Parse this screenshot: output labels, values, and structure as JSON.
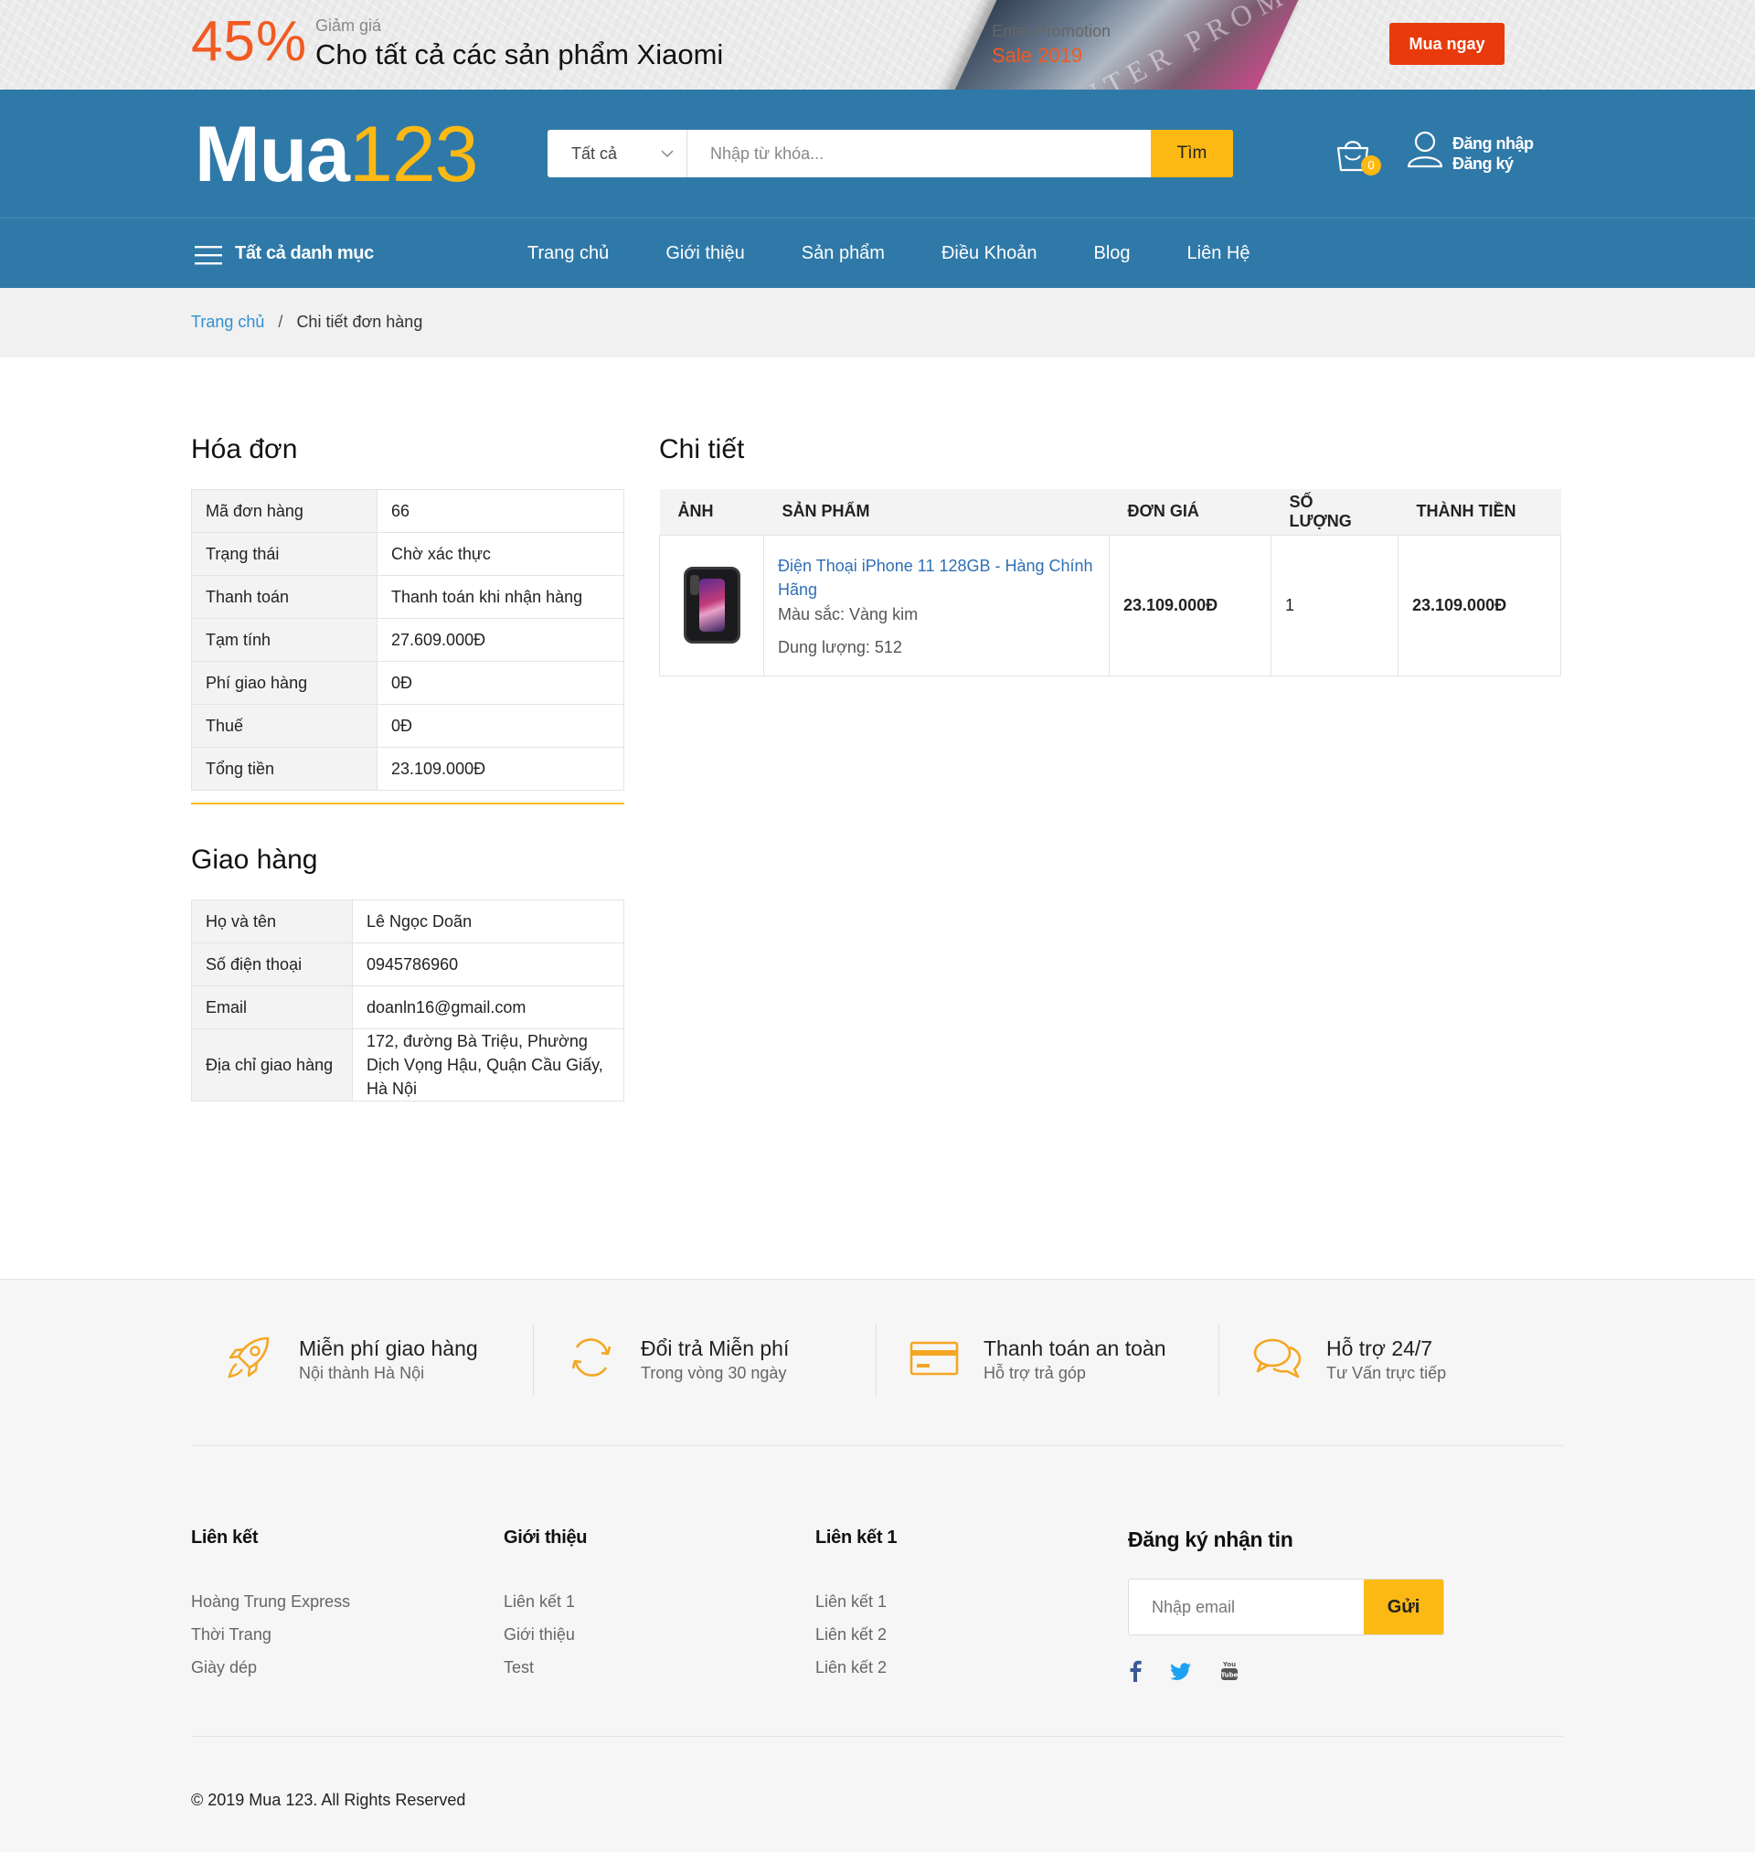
{
  "promo": {
    "percent": "45%",
    "small_text": "Giảm giá",
    "headline": "Cho tất cả các sản phẩm Xiaomi",
    "book_text": "ENTER PROMOTION",
    "enter_text": "Enter Promotion",
    "sale_text": "Sale 2019",
    "button": "Mua ngay",
    "accent_color": "#f15a22",
    "button_color": "#e83a0c"
  },
  "header": {
    "logo_part1": "Mua",
    "logo_part2": "123",
    "search_category": "Tất cả",
    "search_placeholder": "Nhập từ khóa...",
    "search_button": "Tìm",
    "cart_count": "0",
    "login": "Đăng nhập",
    "register": "Đăng ký",
    "brand_color": "#2f79a8",
    "accent_color": "#fdb913"
  },
  "nav": {
    "all_categories": "Tất cả danh mục",
    "items": [
      "Trang chủ",
      "Giới thiệu",
      "Sản phẩm",
      "Điều Khoản",
      "Blog",
      "Liên Hệ"
    ]
  },
  "breadcrumb": {
    "home": "Trang chủ",
    "separator": "/",
    "current": "Chi tiết đơn hàng"
  },
  "invoice": {
    "title": "Hóa đơn",
    "rows": [
      {
        "label": "Mã đơn hàng",
        "value": "66"
      },
      {
        "label": "Trạng thái",
        "value": "Chờ xác thực"
      },
      {
        "label": "Thanh toán",
        "value": "Thanh toán khi nhận hàng"
      },
      {
        "label": "Tạm tính",
        "value": "27.609.000Đ"
      },
      {
        "label": "Phí giao hàng",
        "value": "0Đ"
      },
      {
        "label": "Thuế",
        "value": "0Đ"
      },
      {
        "label": "Tổng tiền",
        "value": "23.109.000Đ"
      }
    ]
  },
  "shipping": {
    "title": "Giao hàng",
    "rows": [
      {
        "label": "Họ và tên",
        "value": "Lê Ngọc Doãn"
      },
      {
        "label": "Số điện thoại",
        "value": "0945786960"
      },
      {
        "label": "Email",
        "value": "doanln16@gmail.com"
      },
      {
        "label": "Địa chỉ giao hàng",
        "value": "172, đường Bà Triệu, Phường Dịch Vọng Hậu, Quận Cầu Giấy, Hà Nội"
      }
    ]
  },
  "details": {
    "title": "Chi tiết",
    "columns": [
      "ẢNH",
      "SẢN PHẨM",
      "ĐƠN GIÁ",
      "SỐ LƯỢNG",
      "THÀNH TIỀN"
    ],
    "items": [
      {
        "image_icon": "iphone-image",
        "name": "Điện Thoại iPhone 11 128GB - Hàng Chính Hãng",
        "color": "Màu sắc: Vàng kim",
        "capacity": "Dung lượng: 512",
        "unit_price": "23.109.000Đ",
        "quantity": "1",
        "total": "23.109.000Đ"
      }
    ]
  },
  "features": [
    {
      "icon": "rocket-icon",
      "title": "Miễn phí giao hàng",
      "subtitle": "Nội thành Hà Nội"
    },
    {
      "icon": "refresh-icon",
      "title": "Đổi trả Miễn phí",
      "subtitle": "Trong vòng 30 ngày"
    },
    {
      "icon": "credit-card-icon",
      "title": "Thanh toán an toàn",
      "subtitle": "Hỗ trợ trả góp"
    },
    {
      "icon": "chat-icon",
      "title": "Hỗ trợ 24/7",
      "subtitle": "Tư Vấn trực tiếp"
    }
  ],
  "footer": {
    "columns": [
      {
        "title": "Liên kết",
        "links": [
          "Hoàng Trung Express",
          "Thời Trang",
          "Giày dép"
        ]
      },
      {
        "title": "Giới thiệu",
        "links": [
          "Liên kết 1",
          "Giới thiệu",
          "Test"
        ]
      },
      {
        "title": "Liên kết 1",
        "links": [
          "Liên kết 1",
          "Liên kết 2",
          "Liên kết 2"
        ]
      }
    ],
    "newsletter_title": "Đăng ký nhận tin",
    "newsletter_placeholder": "Nhập email",
    "newsletter_button": "Gửi",
    "socials": [
      "facebook-icon",
      "twitter-icon",
      "youtube-icon"
    ],
    "copyright": "© 2019 Mua 123. All Rights Reserved"
  }
}
